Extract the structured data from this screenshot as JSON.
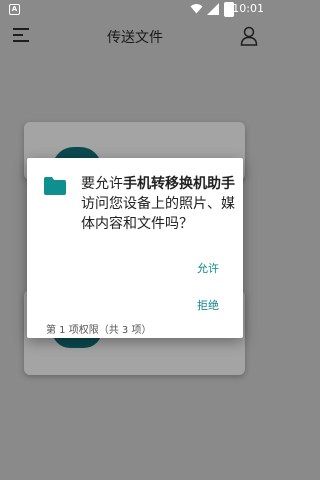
{
  "status_bar": {
    "notification_icon": "A",
    "time": "10:01"
  },
  "app_bar": {
    "title": "传送文件"
  },
  "dialog": {
    "message_prefix": "要允许",
    "app_name": "手机转移换机助手",
    "message_suffix": "访问您设备上的照片、媒体内容和文件吗？",
    "allow_label": "允许",
    "deny_label": "拒绝",
    "footer": "第 1 项权限（共 3 项）",
    "accent_color": "#118a8a"
  },
  "icons": [
    "menu-icon",
    "user-icon",
    "folder-icon",
    "wifi-icon",
    "signal-icon",
    "battery-icon"
  ]
}
